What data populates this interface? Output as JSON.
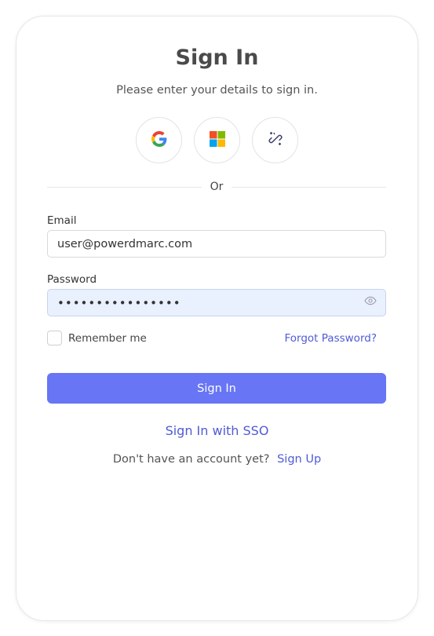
{
  "header": {
    "title": "Sign In",
    "subtitle": "Please enter your details to sign in."
  },
  "social": [
    {
      "name": "Google",
      "icon": "google-icon"
    },
    {
      "name": "Microsoft",
      "icon": "microsoft-icon"
    },
    {
      "name": "Magic Link",
      "icon": "link-sparkle-icon"
    }
  ],
  "divider": {
    "text": "Or"
  },
  "form": {
    "email_label": "Email",
    "email_value": "user@powerdmarc.com",
    "password_label": "Password",
    "password_value": "••••••••••••••••",
    "remember_label": "Remember me",
    "remember_checked": false,
    "forgot_label": "Forgot Password?",
    "submit_label": "Sign In"
  },
  "sso": {
    "label": "Sign In with SSO"
  },
  "signup": {
    "prompt": "Don't have an account yet?",
    "link": "Sign Up"
  },
  "colors": {
    "accent": "#6875f5",
    "link": "#4f5bd5",
    "password_bg": "#e9f0fe"
  }
}
